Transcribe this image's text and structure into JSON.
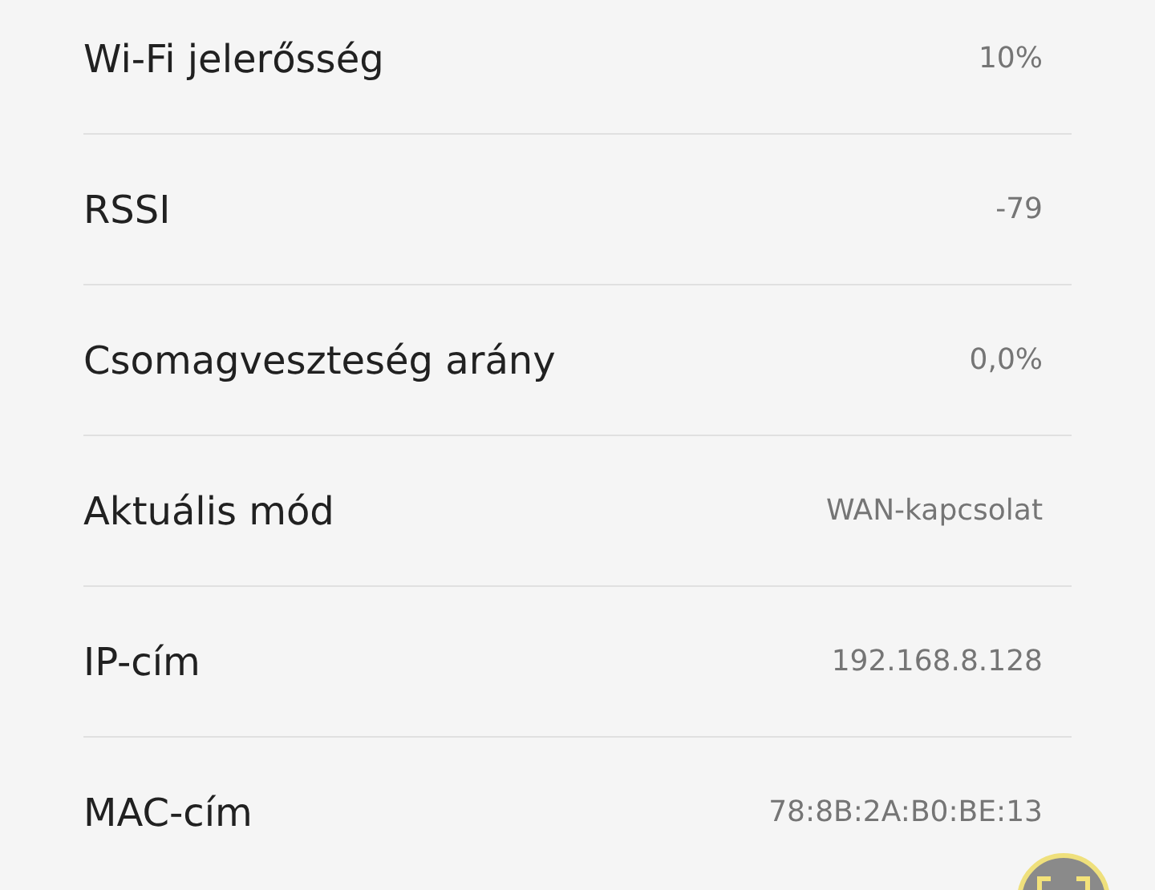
{
  "rows": [
    {
      "label": "Wi-Fi jelerősség",
      "value": "10%"
    },
    {
      "label": "RSSI",
      "value": "-79"
    },
    {
      "label": "Csomagveszteség arány",
      "value": "0,0%"
    },
    {
      "label": "Aktuális mód",
      "value": "WAN-kapcsolat"
    },
    {
      "label": "IP-cím",
      "value": "192.168.8.128"
    },
    {
      "label": "MAC-cím",
      "value": "78:8B:2A:B0:BE:13"
    }
  ]
}
